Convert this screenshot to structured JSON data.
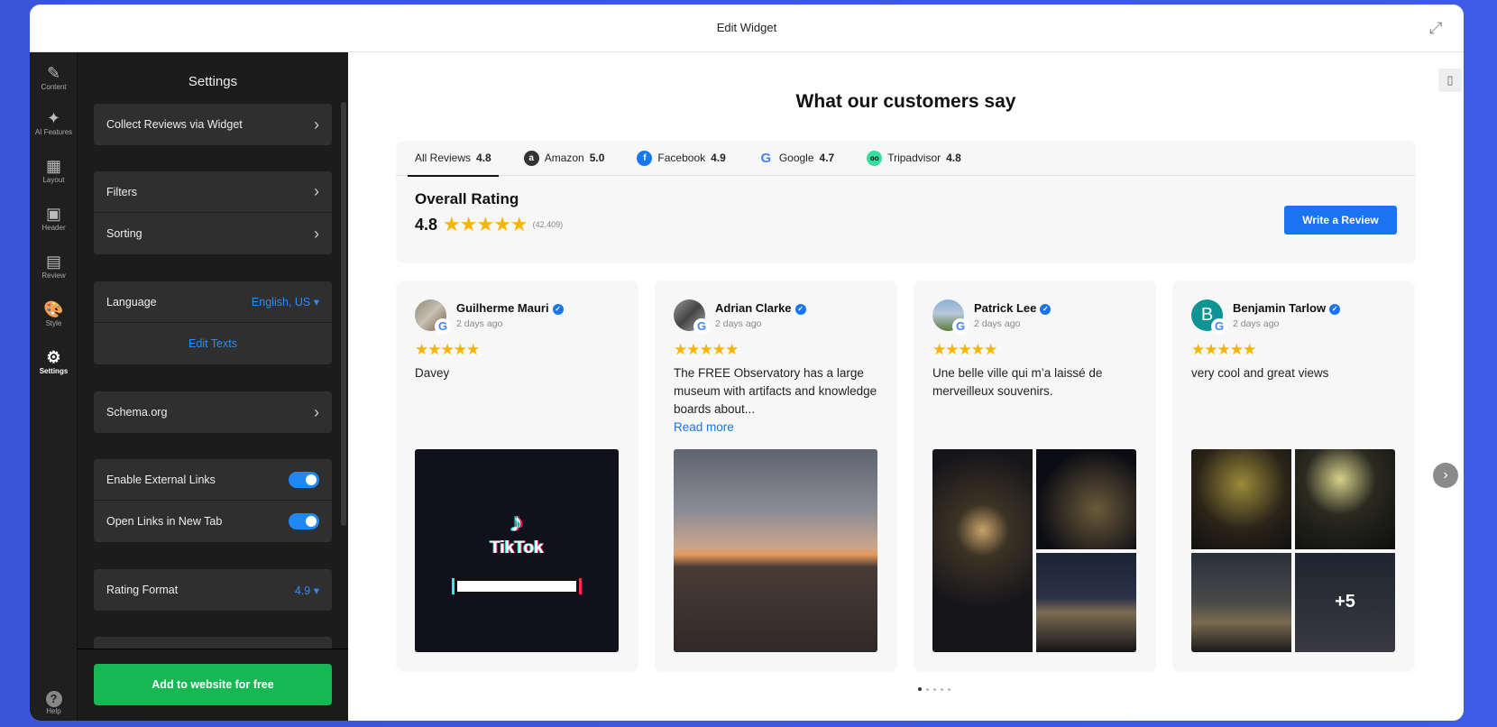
{
  "header": {
    "title": "Edit Widget"
  },
  "rail": [
    {
      "label": "Content",
      "icon": "✎"
    },
    {
      "label": "AI Features",
      "icon": "✦"
    },
    {
      "label": "Layout",
      "icon": "▦"
    },
    {
      "label": "Header",
      "icon": "▣"
    },
    {
      "label": "Review",
      "icon": "▤"
    },
    {
      "label": "Style",
      "icon": "🎨"
    },
    {
      "label": "Settings",
      "icon": "⚙"
    }
  ],
  "help": {
    "label": "Help",
    "icon": "?"
  },
  "panel": {
    "title": "Settings",
    "collect": "Collect Reviews via Widget",
    "filters": "Filters",
    "sorting": "Sorting",
    "language": "Language",
    "language_value": "English, US",
    "edit_texts": "Edit Texts",
    "schema": "Schema.org",
    "external_links": "Enable External Links",
    "new_tab": "Open Links in New Tab",
    "rating_format": "Rating Format",
    "rating_format_value": "4.9",
    "add_button": "Add to website for free",
    "toggles": {
      "external_links": true,
      "new_tab": true
    }
  },
  "widget": {
    "heading": "What our customers say",
    "tabs": [
      {
        "label": "All Reviews",
        "score": "4.8"
      },
      {
        "label": "Amazon",
        "score": "5.0"
      },
      {
        "label": "Facebook",
        "score": "4.9"
      },
      {
        "label": "Google",
        "score": "4.7"
      },
      {
        "label": "Tripadvisor",
        "score": "4.8"
      }
    ],
    "overall_title": "Overall Rating",
    "overall_score": "4.8",
    "overall_count": "(42,409)",
    "write_button": "Write a Review",
    "reviews": [
      {
        "name": "Guilherme Mauri",
        "date": "2 days ago",
        "text": "Davey",
        "read_more": "",
        "initial": ""
      },
      {
        "name": "Adrian Clarke",
        "date": "2 days ago",
        "text": "The FREE Observatory has a large museum with artifacts and knowledge boards about...",
        "read_more": "Read more",
        "initial": ""
      },
      {
        "name": "Patrick Lee",
        "date": "2 days ago",
        "text": "Une belle ville qui m’a laissé de merveilleux souvenirs.",
        "read_more": "",
        "initial": ""
      },
      {
        "name": "Benjamin Tarlow",
        "date": "2 days ago",
        "text": "very cool and great views",
        "read_more": "",
        "initial": "B",
        "extra_photos": "+5"
      }
    ],
    "tiktok_logo": "TikTok"
  },
  "colors": {
    "accent": "#1a73f0",
    "green": "#16b853",
    "star": "#f7b500"
  }
}
